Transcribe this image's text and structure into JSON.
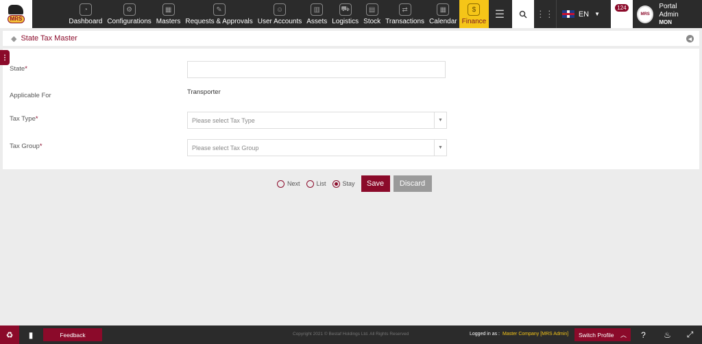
{
  "brand": {
    "logo_text": "MRS"
  },
  "nav": {
    "items": [
      {
        "label": "Dashboard",
        "icon": "dashboard-icon"
      },
      {
        "label": "Configurations",
        "icon": "gears-icon"
      },
      {
        "label": "Masters",
        "icon": "masters-icon"
      },
      {
        "label": "Requests & Approvals",
        "icon": "requests-icon"
      },
      {
        "label": "User Accounts",
        "icon": "user-accounts-icon"
      },
      {
        "label": "Assets",
        "icon": "assets-icon"
      },
      {
        "label": "Logistics",
        "icon": "logistics-icon"
      },
      {
        "label": "Stock",
        "icon": "stock-icon"
      },
      {
        "label": "Transactions",
        "icon": "transactions-icon"
      },
      {
        "label": "Calendar",
        "icon": "calendar-icon"
      },
      {
        "label": "Finance",
        "icon": "finance-icon",
        "active": true
      }
    ],
    "language": "EN",
    "notifications": "124",
    "user_name": "Portal Admin",
    "user_role": "MON"
  },
  "page": {
    "title": "State Tax Master"
  },
  "form": {
    "state_label": "State",
    "applicable_label": "Applicable For",
    "applicable_value": "Transporter",
    "tax_type_label": "Tax Type",
    "tax_type_placeholder": "Please select Tax Type",
    "tax_group_label": "Tax Group",
    "tax_group_placeholder": "Please select Tax Group",
    "required_mark": "*"
  },
  "actions": {
    "next": "Next",
    "list": "List",
    "stay": "Stay",
    "selected": "stay",
    "save": "Save",
    "discard": "Discard"
  },
  "footer": {
    "feedback": "Feedback",
    "copyright": "Copyright 2021 © Bestaf Holdings Ltd. All Rights Reserved",
    "logged_in_as": "Logged in as :",
    "company": "Master Company [MRS Admin]",
    "switch_profile": "Switch Profile"
  },
  "colors": {
    "brand": "#8b0a2a",
    "accent": "#f5c518",
    "nav_bg": "#2b2b2b"
  }
}
